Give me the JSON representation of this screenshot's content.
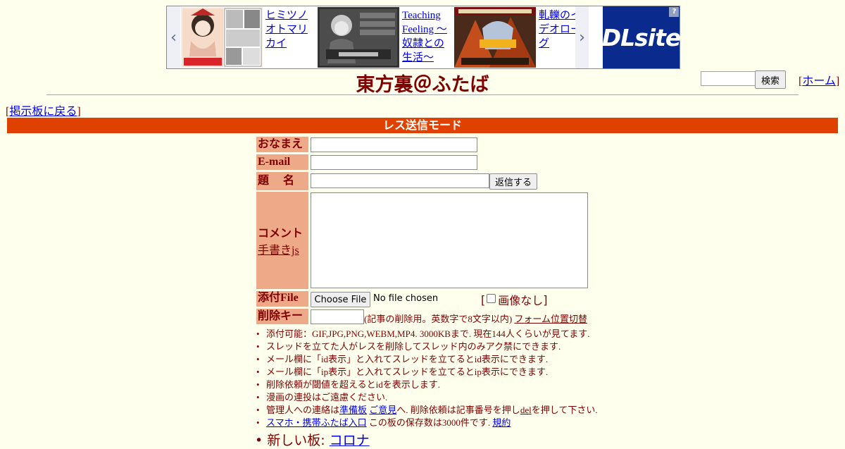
{
  "ad": {
    "items": [
      {
        "label": "ヒミツノオトマリカイ",
        "lines": [
          "ヒミツノ",
          "オトマリ",
          "カイ"
        ]
      },
      {
        "label": "Teaching Feeling 〜奴隷との生活〜",
        "lines": [
          "Teaching",
          "Feeling 〜",
          "奴隷との",
          "生活〜"
        ]
      },
      {
        "label": "軋轢のイデオローグ",
        "lines": [
          "軋轢のイ",
          "デオロー",
          "グ"
        ]
      }
    ],
    "logo_text": "DLsite",
    "corner_mark": "?"
  },
  "header": {
    "title": "東方裏＠ふたば",
    "search_button": "検索",
    "home_open": "[",
    "home_link": "ホーム",
    "home_close": "]"
  },
  "nav": {
    "back_open": "[",
    "back_link": "掲示板に戻る",
    "back_close": "]"
  },
  "mode_bar": "レス送信モード",
  "form": {
    "name_label": "おなまえ",
    "email_label": "E-mail",
    "subject_label": "題　 名",
    "submit_button": "返信する",
    "comment_label": "コメント",
    "handwriting_link": "手書きjs",
    "file_label": "添付File",
    "choose_file_button": "Choose File",
    "no_file_text": "No file chosen",
    "no_image_open": "[",
    "no_image_label": "画像なし",
    "no_image_close": "]",
    "delete_key_label": "削除キー",
    "delete_key_note": "(記事の削除用。英数字で8文字以内)",
    "form_position_link": "フォーム位置切替"
  },
  "notes": {
    "n1": "添付可能：GIF,JPG,PNG,WEBM,MP4. 3000KBまで. 現在144人くらいが見てます.",
    "n2": "スレッドを立てた人がレスを削除してスレッド内のみアク禁にできます.",
    "n3": "メール欄に「id表示」と入れてスレッドを立てるとid表示にできます.",
    "n4": "メール欄に「ip表示」と入れてスレッドを立てるとip表示にできます.",
    "n5": "削除依頼が閾値を超えるとidを表示します.",
    "n6": "漫画の連投はご遠慮ください.",
    "n7_pre": "管理人への連絡は",
    "n7_link1": "準備板",
    "n7_link2": "ご意見",
    "n7_mid": "へ. 削除依頼は記事番号を押し",
    "n7_del": "del",
    "n7_post": "を押して下さい.",
    "n8_link": "スマホ・携帯ふたば入口",
    "n8_mid": "この板の保存数は3000件です.",
    "n8_link2": "規約"
  },
  "new_board": {
    "prefix": "新しい板:",
    "link": "コロナ"
  }
}
